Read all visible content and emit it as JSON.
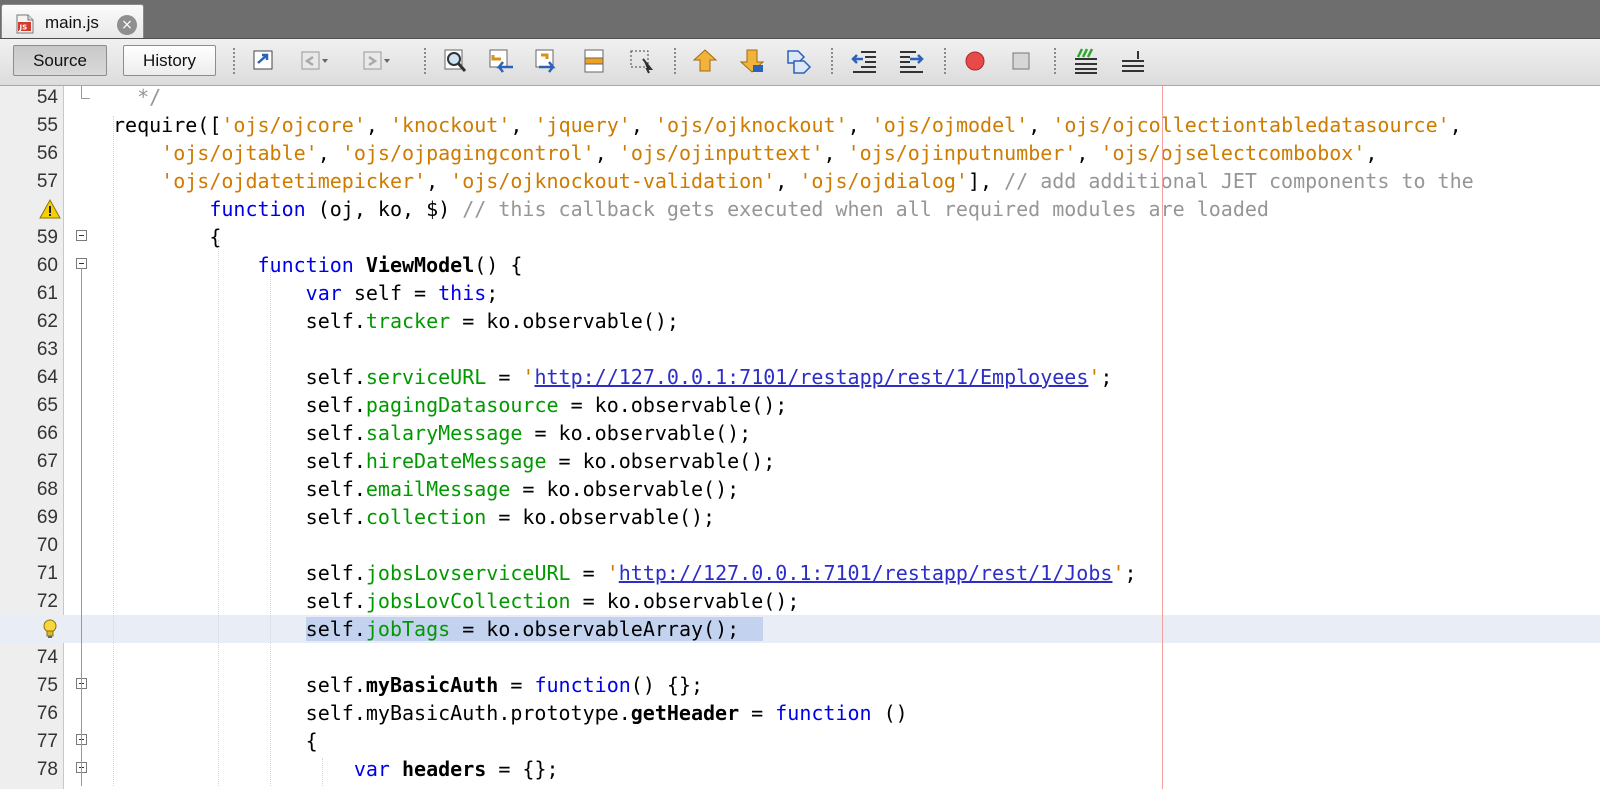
{
  "tab": {
    "label": "main.js",
    "icon": "js-file-icon"
  },
  "toolbar": {
    "source_label": "Source",
    "history_label": "History"
  },
  "editor": {
    "lines": [
      {
        "num": "54",
        "tokens": [
          [
            "c",
            "  */"
          ]
        ]
      },
      {
        "num": "55",
        "tokens": [
          [
            "p",
            "require(["
          ],
          [
            "s",
            "'ojs/ojcore'"
          ],
          [
            "p",
            ", "
          ],
          [
            "s",
            "'knockout'"
          ],
          [
            "p",
            ", "
          ],
          [
            "s",
            "'jquery'"
          ],
          [
            "p",
            ", "
          ],
          [
            "s",
            "'ojs/ojknockout'"
          ],
          [
            "p",
            ", "
          ],
          [
            "s",
            "'ojs/ojmodel'"
          ],
          [
            "p",
            ", "
          ],
          [
            "s",
            "'ojs/ojcollectiontabledatasource'"
          ],
          [
            "p",
            ","
          ]
        ]
      },
      {
        "num": "56",
        "tokens": [
          [
            "p",
            "    "
          ],
          [
            "s",
            "'ojs/ojtable'"
          ],
          [
            "p",
            ", "
          ],
          [
            "s",
            "'ojs/ojpagingcontrol'"
          ],
          [
            "p",
            ", "
          ],
          [
            "s",
            "'ojs/ojinputtext'"
          ],
          [
            "p",
            ", "
          ],
          [
            "s",
            "'ojs/ojinputnumber'"
          ],
          [
            "p",
            ", "
          ],
          [
            "s",
            "'ojs/ojselectcombobox'"
          ],
          [
            "p",
            ","
          ]
        ]
      },
      {
        "num": "57",
        "tokens": [
          [
            "p",
            "    "
          ],
          [
            "s",
            "'ojs/ojdatetimepicker'"
          ],
          [
            "p",
            ", "
          ],
          [
            "s",
            "'ojs/ojknockout-validation'"
          ],
          [
            "p",
            ", "
          ],
          [
            "s",
            "'ojs/ojdialog'"
          ],
          [
            "p",
            "], "
          ],
          [
            "c",
            "// add additional JET components to the"
          ]
        ]
      },
      {
        "num": "",
        "marker": "warning",
        "tokens": [
          [
            "p",
            "        "
          ],
          [
            "k",
            "function"
          ],
          [
            "p",
            " (oj, ko, $) "
          ],
          [
            "c",
            "// this callback gets executed when all required modules are loaded"
          ]
        ]
      },
      {
        "num": "59",
        "fold": true,
        "tokens": [
          [
            "p",
            "        {"
          ]
        ]
      },
      {
        "num": "60",
        "fold": true,
        "tokens": [
          [
            "p",
            "            "
          ],
          [
            "k",
            "function"
          ],
          [
            "p",
            " "
          ],
          [
            "b",
            "ViewModel"
          ],
          [
            "p",
            "() {"
          ]
        ]
      },
      {
        "num": "61",
        "tokens": [
          [
            "p",
            "                "
          ],
          [
            "k",
            "var"
          ],
          [
            "p",
            " self = "
          ],
          [
            "k",
            "this"
          ],
          [
            "p",
            ";"
          ]
        ]
      },
      {
        "num": "62",
        "tokens": [
          [
            "p",
            "                self."
          ],
          [
            "f",
            "tracker"
          ],
          [
            "p",
            " = ko.observable();"
          ]
        ]
      },
      {
        "num": "63",
        "tokens": []
      },
      {
        "num": "64",
        "tokens": [
          [
            "p",
            "                self."
          ],
          [
            "f",
            "serviceURL"
          ],
          [
            "p",
            " = "
          ],
          [
            "s",
            "'"
          ],
          [
            "u",
            "http://127.0.0.1:7101/restapp/rest/1/Employees"
          ],
          [
            "s",
            "'"
          ],
          [
            "p",
            ";"
          ]
        ]
      },
      {
        "num": "65",
        "tokens": [
          [
            "p",
            "                self."
          ],
          [
            "f",
            "pagingDatasource"
          ],
          [
            "p",
            " = ko.observable();"
          ]
        ]
      },
      {
        "num": "66",
        "tokens": [
          [
            "p",
            "                self."
          ],
          [
            "f",
            "salaryMessage"
          ],
          [
            "p",
            " = ko.observable();"
          ]
        ]
      },
      {
        "num": "67",
        "tokens": [
          [
            "p",
            "                self."
          ],
          [
            "f",
            "hireDateMessage"
          ],
          [
            "p",
            " = ko.observable();"
          ]
        ]
      },
      {
        "num": "68",
        "tokens": [
          [
            "p",
            "                self."
          ],
          [
            "f",
            "emailMessage"
          ],
          [
            "p",
            " = ko.observable();"
          ]
        ]
      },
      {
        "num": "69",
        "tokens": [
          [
            "p",
            "                self."
          ],
          [
            "f",
            "collection"
          ],
          [
            "p",
            " = ko.observable();"
          ]
        ]
      },
      {
        "num": "70",
        "tokens": []
      },
      {
        "num": "71",
        "tokens": [
          [
            "p",
            "                self."
          ],
          [
            "f",
            "jobsLovserviceURL"
          ],
          [
            "p",
            " = "
          ],
          [
            "s",
            "'"
          ],
          [
            "u",
            "http://127.0.0.1:7101/restapp/rest/1/Jobs"
          ],
          [
            "s",
            "'"
          ],
          [
            "p",
            ";"
          ]
        ]
      },
      {
        "num": "72",
        "tokens": [
          [
            "p",
            "                self."
          ],
          [
            "f",
            "jobsLovCollection"
          ],
          [
            "p",
            " = ko.observable();"
          ]
        ]
      },
      {
        "num": "",
        "marker": "bulb",
        "highlight": true,
        "tokens": [
          [
            "p",
            "                "
          ],
          [
            "selp",
            "self."
          ],
          [
            "self",
            "jobTags"
          ],
          [
            "selp",
            " = ko.observableArray();  "
          ]
        ]
      },
      {
        "num": "74",
        "tokens": []
      },
      {
        "num": "75",
        "fold": true,
        "tokens": [
          [
            "p",
            "                self."
          ],
          [
            "b",
            "myBasicAuth"
          ],
          [
            "p",
            " = "
          ],
          [
            "k",
            "function"
          ],
          [
            "p",
            "() {};"
          ]
        ]
      },
      {
        "num": "76",
        "tokens": [
          [
            "p",
            "                self.myBasicAuth.prototype."
          ],
          [
            "b",
            "getHeader"
          ],
          [
            "p",
            " = "
          ],
          [
            "k",
            "function"
          ],
          [
            "p",
            " ()"
          ]
        ]
      },
      {
        "num": "77",
        "fold": true,
        "tokens": [
          [
            "p",
            "                {"
          ]
        ]
      },
      {
        "num": "78",
        "fold": true,
        "tokens": [
          [
            "p",
            "                    "
          ],
          [
            "k",
            "var"
          ],
          [
            "p",
            " "
          ],
          [
            "b",
            "headers"
          ],
          [
            "p",
            " = {};"
          ]
        ]
      }
    ]
  }
}
